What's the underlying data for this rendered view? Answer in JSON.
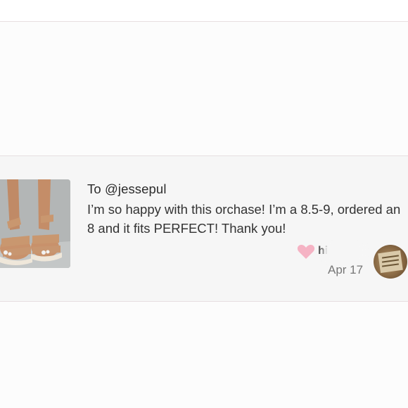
{
  "review": {
    "to_line": "To @jessepul",
    "text": "I’m so happy with this orchase! I’m a 8.5-9, ordered an 8 and it fits PERFECT! Thank you!",
    "username": "hi",
    "date": "Apr 17"
  },
  "colors": {
    "heart": "#f5b3c4",
    "divider": "#e7dfe1",
    "card_bg": "#f6f6f6"
  },
  "icons": {
    "like": "heart-icon"
  }
}
